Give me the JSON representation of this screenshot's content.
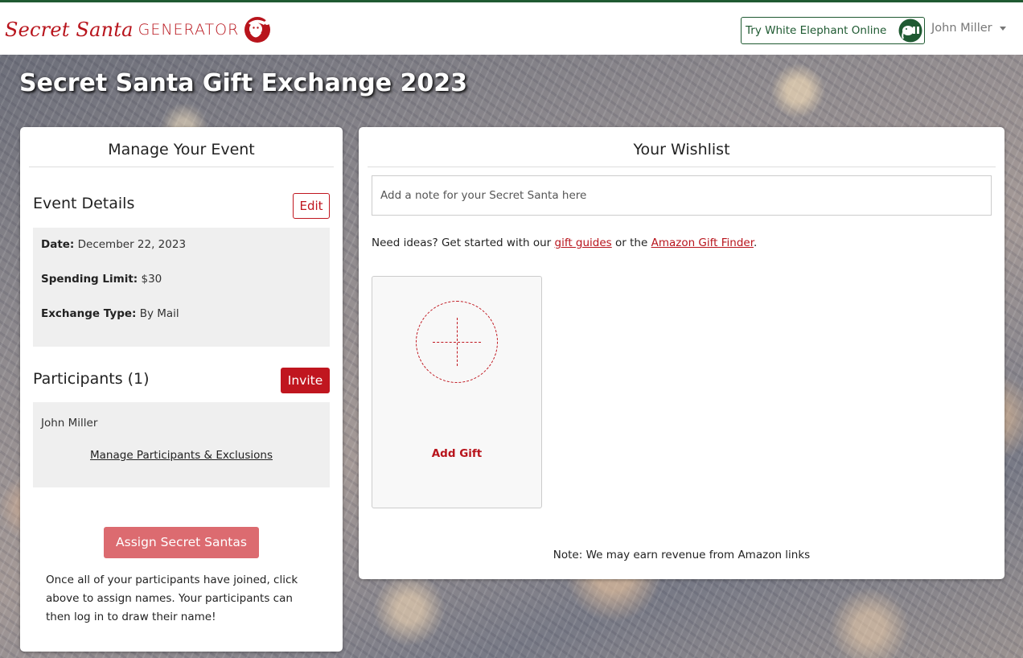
{
  "nav": {
    "brand_script": "Secret Santa",
    "brand_caps": "GENERATOR",
    "logo_icon": "santa-logo-icon",
    "try_button": "Try White Elephant Online",
    "try_icon": "elephant-icon",
    "user_name": "John Miller"
  },
  "page": {
    "title": "Secret Santa Gift Exchange 2023"
  },
  "manage": {
    "heading": "Manage Your Event",
    "details_title": "Event Details",
    "edit_label": "Edit",
    "date_label": "Date:",
    "date_value": "December 22, 2023",
    "limit_label": "Spending Limit:",
    "limit_value": "$30",
    "type_label": "Exchange Type:",
    "type_value": "By Mail",
    "participants_title": "Participants (1)",
    "invite_label": "Invite",
    "participants": [
      "John Miller"
    ],
    "manage_link": "Manage Participants & Exclusions",
    "assign_label": "Assign Secret Santas",
    "help_text": "Once all of your participants have joined, click above to assign names. Your participants can then log in to draw their name!"
  },
  "wishlist": {
    "heading": "Your Wishlist",
    "note_placeholder": "Add a note for your Secret Santa here",
    "ideas_prefix": "Need ideas? Get started with our ",
    "gift_guides": "gift guides",
    "ideas_mid": " or the ",
    "gift_finder": "Amazon Gift Finder",
    "ideas_suffix": ".",
    "add_gift_label": "Add Gift",
    "footer_note": "Note: We may earn revenue from Amazon links"
  },
  "colors": {
    "brand_red": "#c0161f",
    "brand_green": "#1f5a32",
    "assign_button": "#dc6b70"
  }
}
